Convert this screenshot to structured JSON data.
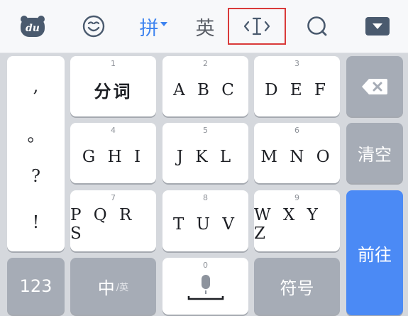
{
  "toolbar": {
    "logo_text": "du",
    "pinyin_label": "拼",
    "english_label": "英",
    "accent_color": "#3d83f0",
    "highlight_color": "#d93a3a"
  },
  "punctuation": [
    ",",
    "。",
    "?",
    "!"
  ],
  "keys": [
    {
      "num": "1",
      "label": "分词"
    },
    {
      "num": "2",
      "label": "A B C"
    },
    {
      "num": "3",
      "label": "D E F"
    },
    {
      "num": "4",
      "label": "G H I"
    },
    {
      "num": "5",
      "label": "J K L"
    },
    {
      "num": "6",
      "label": "M N O"
    },
    {
      "num": "7",
      "label": "P Q R S"
    },
    {
      "num": "8",
      "label": "T U V"
    },
    {
      "num": "9",
      "label": "W X Y Z"
    }
  ],
  "side": {
    "clear_label": "清空",
    "go_label": "前往"
  },
  "bottom": {
    "numbers_label": "123",
    "lang_main": "中",
    "lang_sub": "/英",
    "space_num": "0",
    "symbols_label": "符号"
  }
}
